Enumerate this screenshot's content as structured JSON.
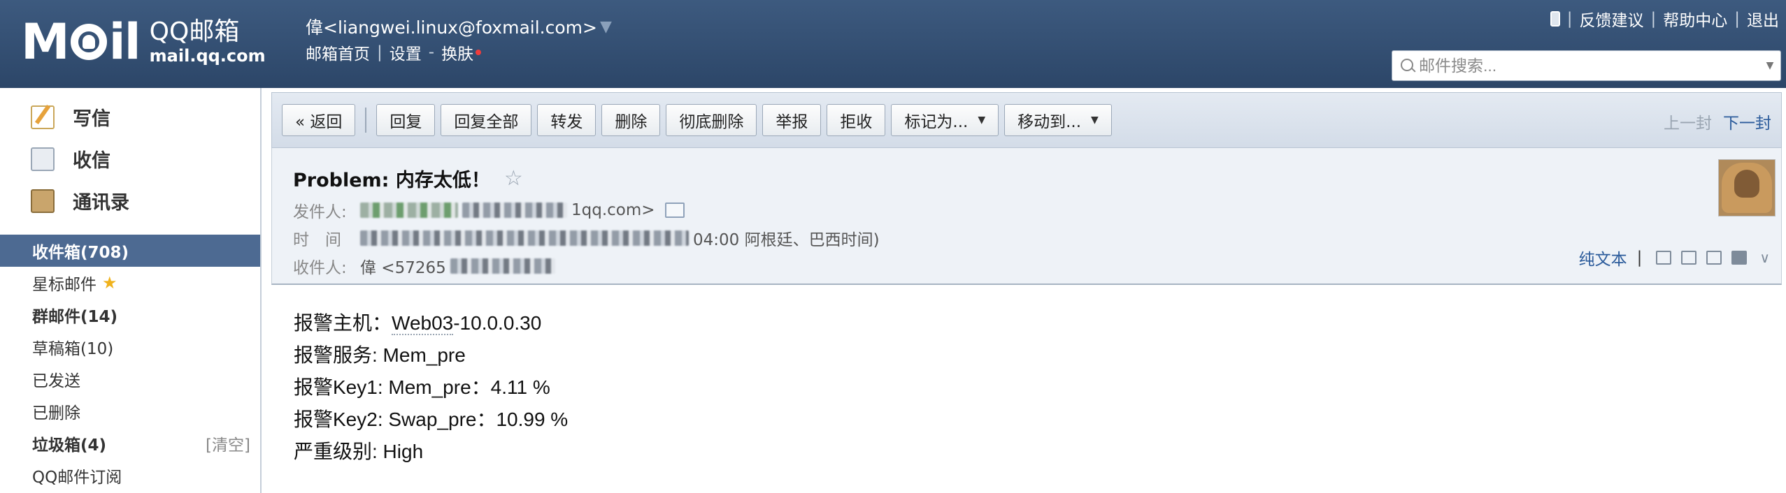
{
  "header": {
    "logo_cn": "QQ邮箱",
    "logo_en": "mail.qq.com",
    "user_name": "偉<liangwei.linux@foxmail.com>",
    "links": [
      "邮箱首页",
      "设置",
      "换肤"
    ],
    "links_sep": "|",
    "links_dash": "-",
    "top_right": [
      "反馈建议",
      "帮助中心",
      "退出"
    ],
    "search_placeholder": "邮件搜索..."
  },
  "sidebar": {
    "actions": [
      {
        "label": "写信",
        "icon": "compose-icon"
      },
      {
        "label": "收信",
        "icon": "inbox-icon"
      },
      {
        "label": "通讯录",
        "icon": "contacts-icon"
      }
    ],
    "folders": [
      {
        "label": "收件箱(708)",
        "active": true,
        "bold": true
      },
      {
        "label": "星标邮件",
        "star": "★"
      },
      {
        "label": "群邮件(14)",
        "bold": true
      },
      {
        "label": "草稿箱(10)"
      },
      {
        "label": "已发送"
      },
      {
        "label": "已删除"
      },
      {
        "label": "垃圾箱(4)",
        "bold": true,
        "clear": "[清空]"
      },
      {
        "label": "QQ邮件订阅"
      }
    ]
  },
  "toolbar": {
    "back": "« 返回",
    "reply": "回复",
    "reply_all": "回复全部",
    "forward": "转发",
    "delete": "删除",
    "delete_forever": "彻底删除",
    "report": "举报",
    "reject": "拒收",
    "mark_as": "标记为...",
    "move_to": "移动到...",
    "prev": "上一封",
    "next": "下一封"
  },
  "mail": {
    "subject": "Problem: 内存太低！",
    "star": "☆",
    "from_label": "发件人:",
    "from_visible_tail": "1qq.com>",
    "time_label": "时　间",
    "time_visible_tail": "04:00 阿根廷、巴西时间)",
    "to_label": "收件人:",
    "to_visible": "偉 <57265",
    "plain_text": "纯文本",
    "plain_sep": "|",
    "more_icon": "chevron-down-icon"
  },
  "body": {
    "line1_prefix": "报警主机：",
    "line1_host": "Web03",
    "line1_rest": "-10.0.0.30",
    "line2": "报警服务: Mem_pre",
    "line3": "报警Key1: Mem_pre：4.11 %",
    "line4": "报警Key2: Swap_pre：10.99 %",
    "line5": "严重级别: High"
  }
}
